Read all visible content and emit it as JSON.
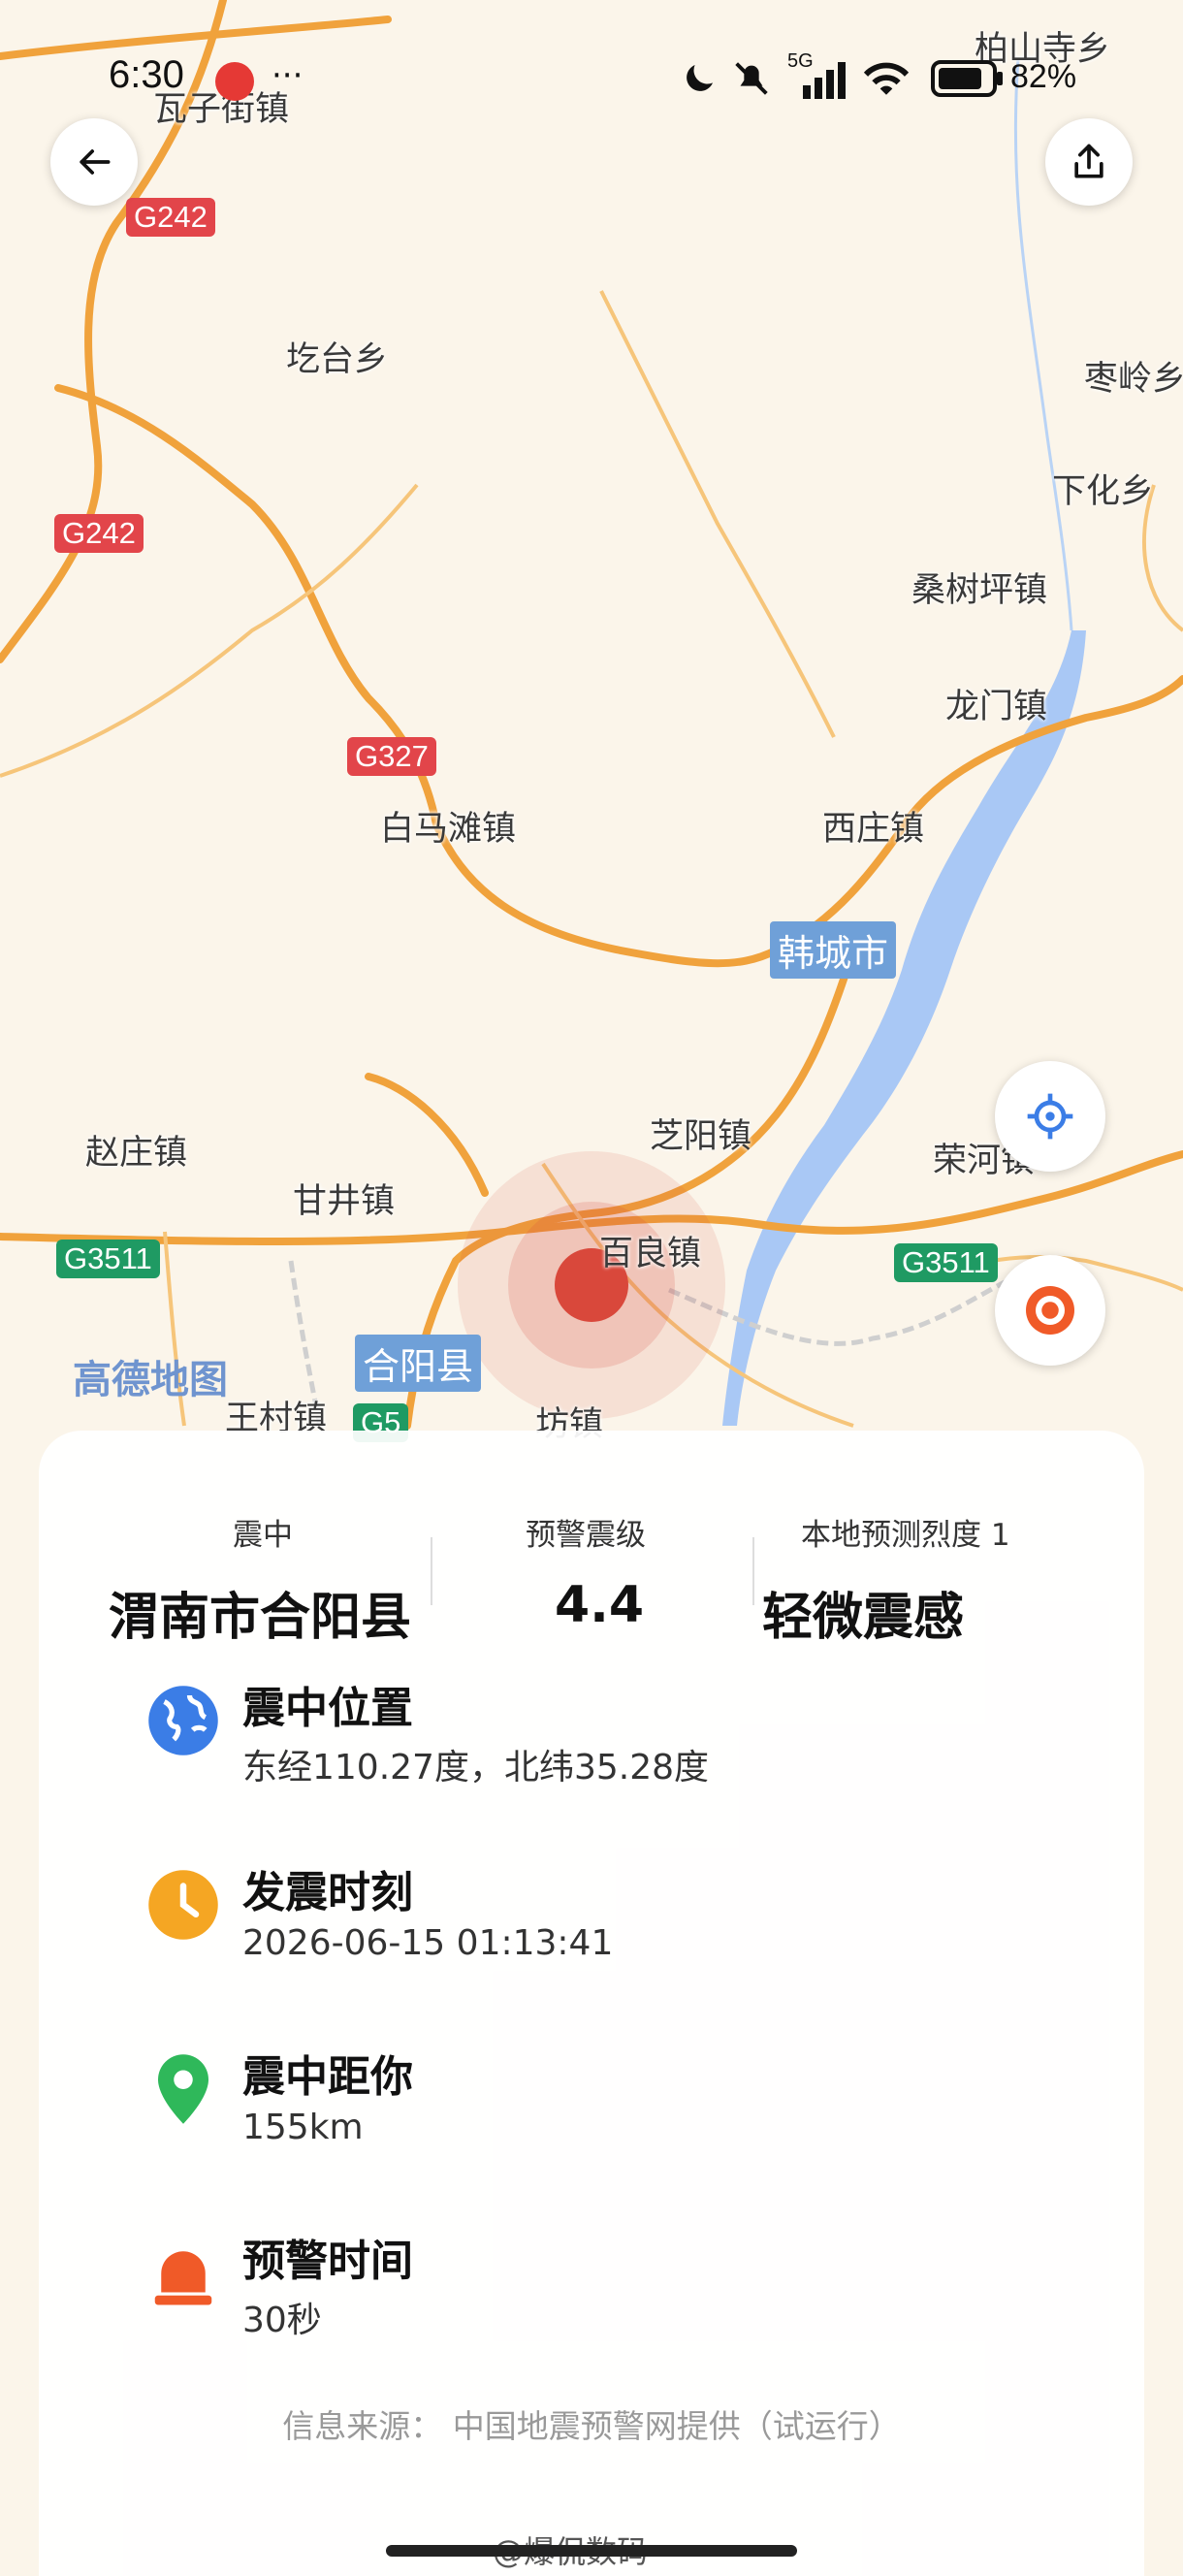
{
  "status_bar": {
    "time": "6:30",
    "network": "5G",
    "battery": "82%"
  },
  "map": {
    "places": [
      "柏山寺乡",
      "瓦子街镇",
      "圪台乡",
      "枣岭乡",
      "下化乡",
      "桑树坪镇",
      "龙门镇",
      "白马滩镇",
      "西庄镇",
      "芝阳镇",
      "赵庄镇",
      "甘井镇",
      "百良镇",
      "荣河镇",
      "王村镇",
      "坊镇"
    ],
    "highways": [
      "G242",
      "G242",
      "G327",
      "G3511",
      "G3511",
      "G5"
    ],
    "cities": [
      "韩城市",
      "合阳县"
    ],
    "watermark": "高德地图"
  },
  "summary": {
    "epicenter_label": "震中",
    "epicenter_value": "渭南市合阳县",
    "magnitude_label": "预警震级",
    "magnitude_value": "4.4",
    "intensity_label": "本地预测烈度 1",
    "intensity_value": "轻微震感"
  },
  "details": [
    {
      "title": "震中位置",
      "value": "东经110.27度，北纬35.28度",
      "icon": "globe-icon",
      "color": "#3b7de6"
    },
    {
      "title": "发震时刻",
      "value": "2026-06-15 01:13:41",
      "icon": "clock-icon",
      "color": "#f5a623"
    },
    {
      "title": "震中距你",
      "value": "155km",
      "icon": "location-pin-icon",
      "color": "#2fb85a"
    },
    {
      "title": "预警时间",
      "value": "30秒",
      "icon": "alarm-icon",
      "color": "#f05a28"
    }
  ],
  "source": "信息来源： 中国地震预警网提供（试运行）",
  "footer_watermark": "@爆侃数码",
  "colors": {
    "epicenter": "#d9483b",
    "river": "#a9c8f5",
    "road": "#f0a23c"
  }
}
